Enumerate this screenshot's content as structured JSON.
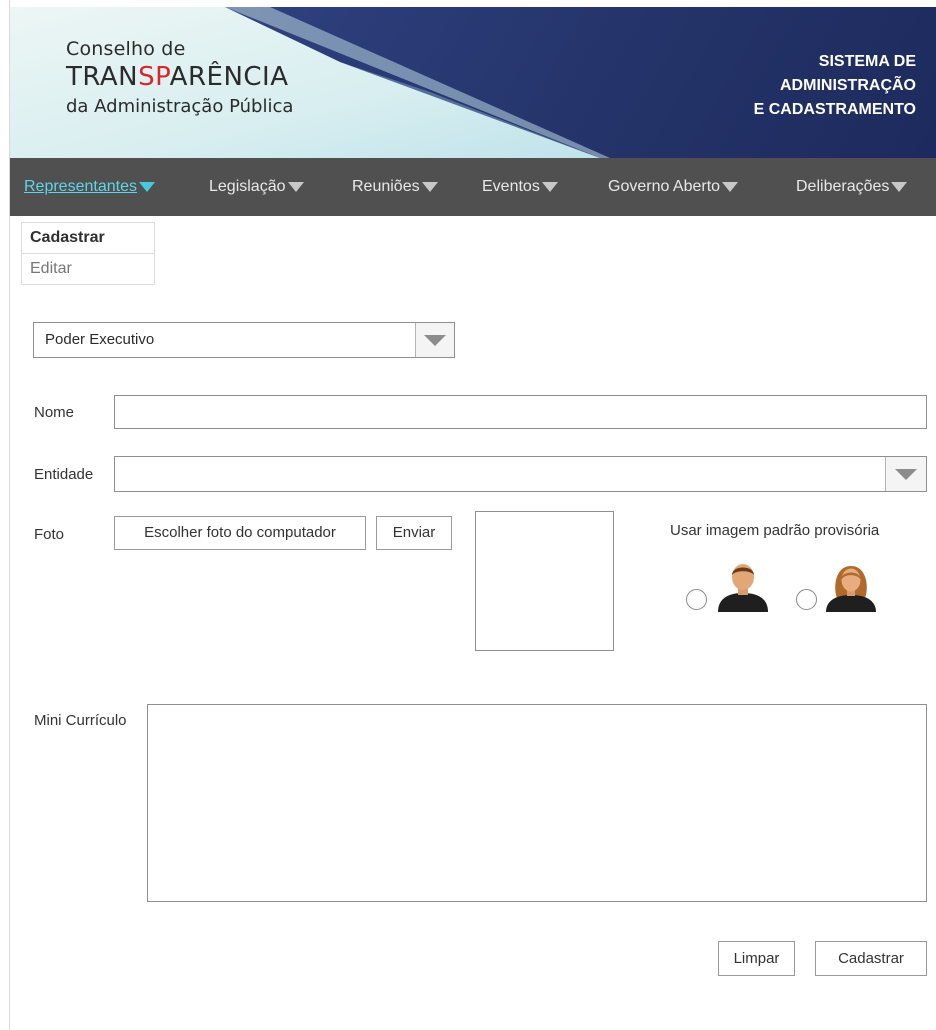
{
  "header": {
    "logo_line1": "Conselho de",
    "logo_line2_a": "TRAN",
    "logo_line2_b": "SP",
    "logo_line2_c": "ARÊNCIA",
    "logo_line3": "da Administração Pública",
    "system_title_line1": "SISTEMA DE",
    "system_title_line2": "ADMINISTRAÇÃO",
    "system_title_line3": "E CADASTRAMENTO"
  },
  "nav": {
    "items": [
      {
        "label": "Representantes",
        "active": true
      },
      {
        "label": "Legislação"
      },
      {
        "label": "Reuniões"
      },
      {
        "label": "Eventos"
      },
      {
        "label": "Governo Aberto"
      },
      {
        "label": "Deliberações"
      }
    ]
  },
  "submenu": {
    "items": [
      "Cadastrar",
      "Editar"
    ]
  },
  "form": {
    "poder_select_value": "Poder Executivo",
    "nome_label": "Nome",
    "nome_value": "",
    "entidade_label": "Entidade",
    "entidade_value": "",
    "foto_label": "Foto",
    "choose_photo_button": "Escolher foto do computador",
    "send_button": "Enviar",
    "default_image_label": "Usar imagem padrão provisória",
    "curriculo_label": "Mini Currículo",
    "curriculo_value": ""
  },
  "actions": {
    "clear_button": "Limpar",
    "submit_button": "Cadastrar"
  },
  "colors": {
    "banner_blue": "#233267",
    "nav_bg": "#505050",
    "active_link": "#5ed6e8",
    "logo_accent": "#d8262f"
  },
  "icons": [
    "dropdown-arrow-icon",
    "male-avatar-icon",
    "female-avatar-icon"
  ]
}
